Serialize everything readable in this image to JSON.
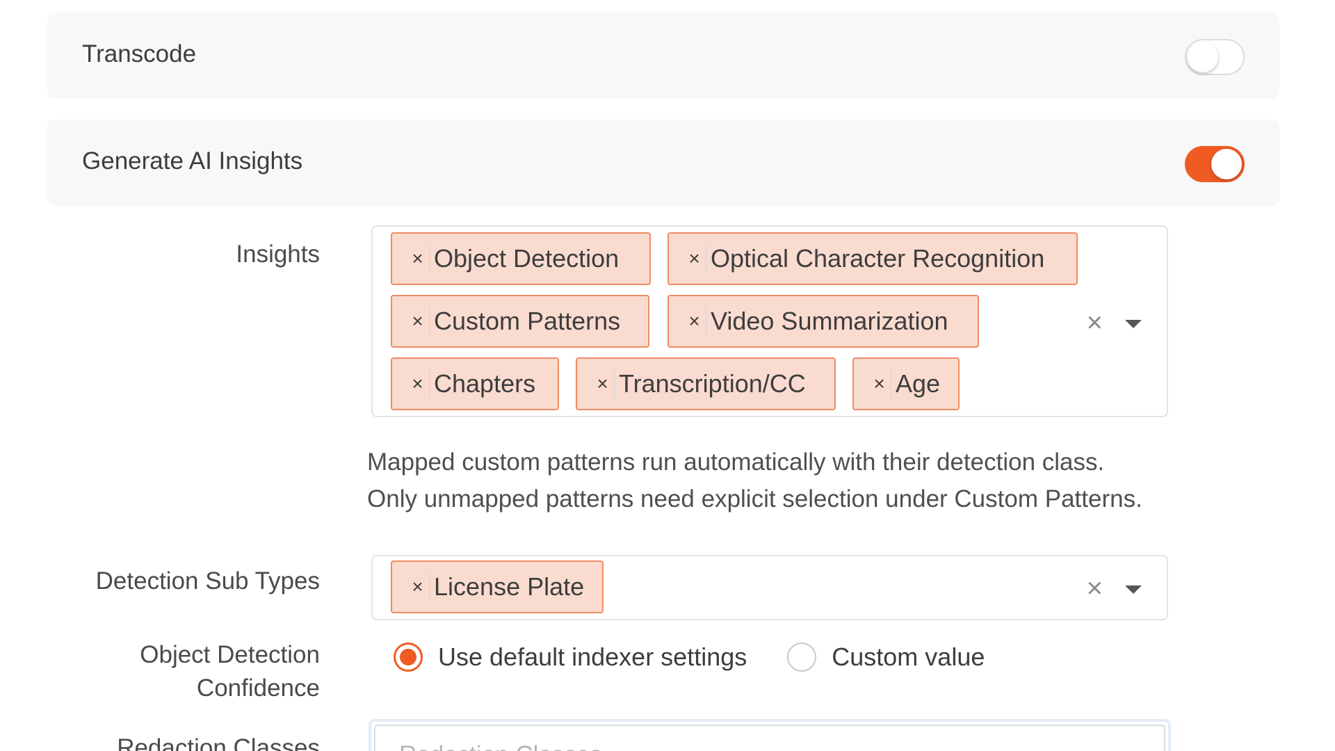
{
  "transcode": {
    "title": "Transcode",
    "enabled": false
  },
  "ai_insights": {
    "title": "Generate AI Insights",
    "enabled": true
  },
  "insights": {
    "label": "Insights",
    "tags": [
      "Object Detection",
      "Optical Character Recognition",
      "Custom Patterns",
      "Video Summarization",
      "Chapters",
      "Transcription/CC",
      "Age"
    ],
    "remove_glyph": "×",
    "clear_glyph": "×",
    "help_text": "Mapped custom patterns run automatically with their detection class. Only unmapped patterns need explicit selection under Custom Patterns."
  },
  "detection_sub_types": {
    "label": "Detection Sub Types",
    "tags": [
      "License Plate"
    ],
    "remove_glyph": "×",
    "clear_glyph": "×"
  },
  "object_detection_confidence": {
    "label_line1": "Object Detection",
    "label_line2": "Confidence",
    "options": [
      {
        "label": "Use default indexer settings",
        "checked": true
      },
      {
        "label": "Custom value",
        "checked": false
      }
    ]
  },
  "redaction_classes": {
    "label": "Redaction Classes",
    "placeholder": "Redaction Classes"
  },
  "colors": {
    "accent": "#f05a23",
    "tag_bg": "#fadbcf",
    "tag_border": "#ef8c63",
    "card_bg": "#f8f8f8"
  },
  "icons": {
    "tag_remove": "close-icon",
    "clear_all": "clear-icon",
    "dropdown": "chevron-down-icon"
  }
}
